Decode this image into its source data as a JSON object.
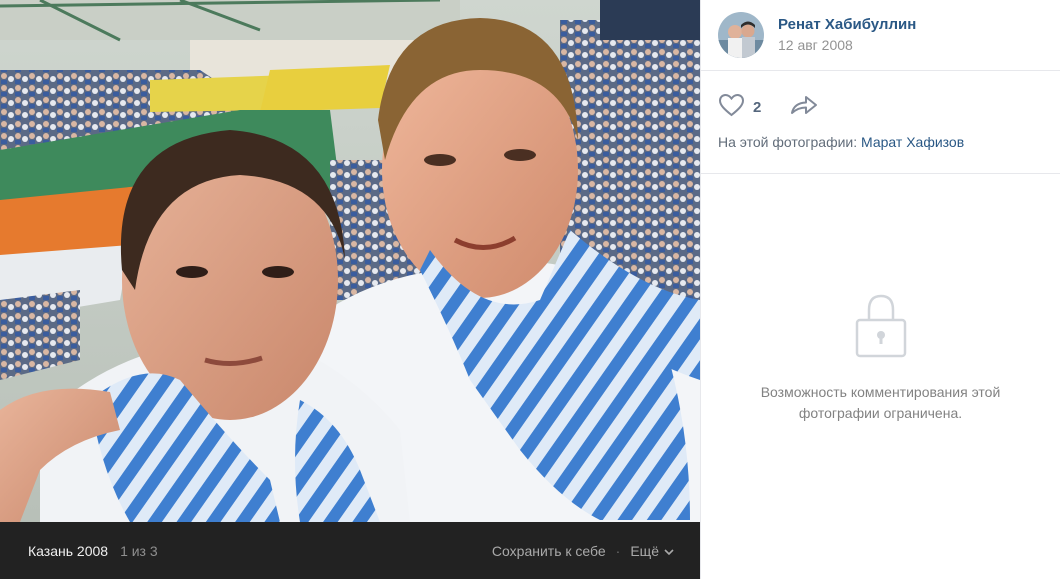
{
  "author": {
    "name": "Ренат Хабибуллин",
    "date": "12 авг 2008"
  },
  "actions": {
    "like_count": "2",
    "tags_label": "На этой фотографии:",
    "tagged_person": "Марат Хафизов"
  },
  "comments": {
    "locked_line1": "Возможность комментирования этой",
    "locked_line2": "фотографии ограничена."
  },
  "photo_bar": {
    "album": "Казань 2008",
    "counter": "1 из 3",
    "save": "Сохранить к себе",
    "separator": "·",
    "more": "Ещё"
  },
  "icons": {
    "like": "heart-icon",
    "share": "share-arrow-icon",
    "lock": "lock-icon",
    "more": "chevron-down-icon"
  },
  "colors": {
    "link_blue": "#2a5885",
    "bar_bg": "#222222",
    "muted_text": "#828282"
  }
}
